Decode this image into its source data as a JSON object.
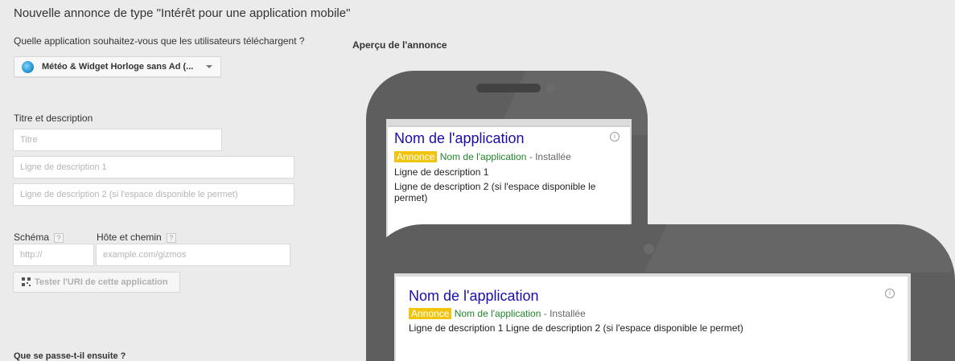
{
  "page": {
    "title": "Nouvelle annonce de type \"Intérêt pour une application mobile\"",
    "app_question": "Quelle application souhaitez-vous que les utilisateurs téléchargent ?",
    "selected_app": "Météo & Widget Horloge sans Ad (...",
    "title_section": "Titre et description",
    "next_section": "Que se passe-t-il ensuite ?"
  },
  "form": {
    "titre_placeholder": "Titre",
    "desc1_placeholder": "Ligne de description 1",
    "desc2_placeholder": "Ligne de description 2 (si l'espace disponible le permet)",
    "scheme_label": "Schéma",
    "host_label": "Hôte et chemin",
    "help_glyph": "?",
    "scheme_placeholder": "http://",
    "host_placeholder": "example.com/gizmos",
    "test_button": "Tester l'URI de cette application"
  },
  "preview": {
    "heading": "Aperçu de l'annonce",
    "ad_title": "Nom de l'application",
    "badge": "Annonce",
    "app_name": "Nom de l'application",
    "separator": " - ",
    "installed": "Installée",
    "desc1": "Ligne de description 1",
    "desc2_line1": "Ligne de description 2 (si l'espace disponible le",
    "desc2_line2": "permet)",
    "desc_combined": "Ligne de description 1 Ligne de description 2 (si l'espace disponible le permet)",
    "info_glyph": "i"
  },
  "icons": {
    "app": "weather-app-icon",
    "caret": "chevron-down-icon",
    "qr": "qr-code-icon",
    "info": "info-icon"
  },
  "colors": {
    "badge": "#f1c40f",
    "ad_title": "#1a0dab",
    "app_name": "#21852a"
  }
}
